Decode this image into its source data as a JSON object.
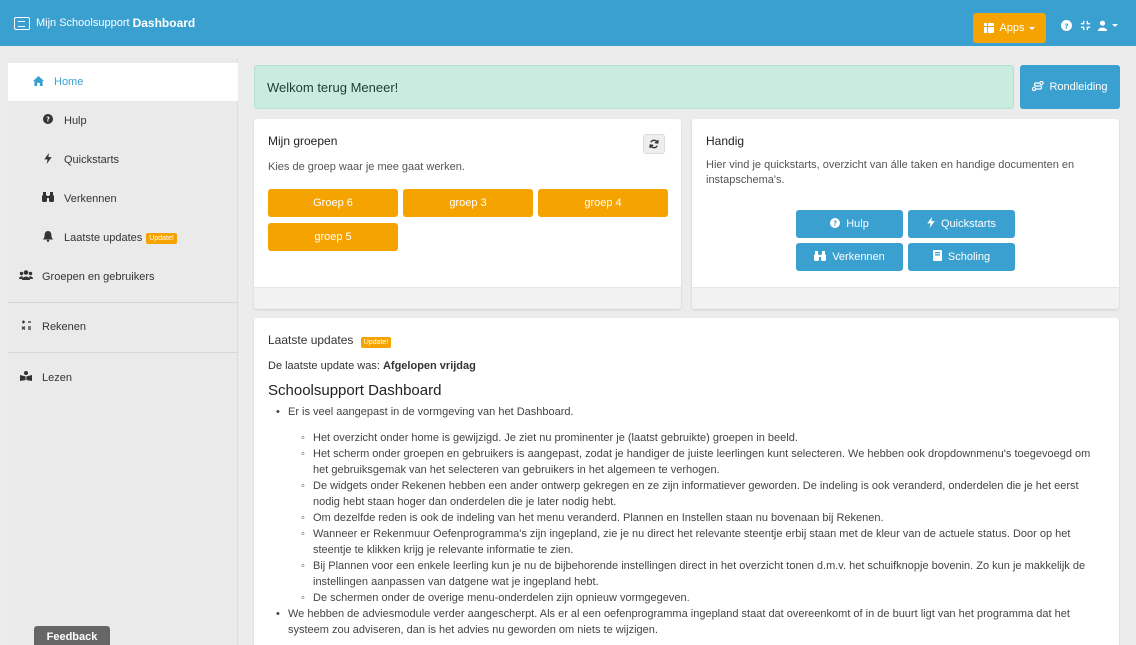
{
  "header": {
    "brand_prefix": "Mijn Schoolsupport",
    "brand_bold": "Dashboard",
    "apps_label": "Apps"
  },
  "sidebar": {
    "items": [
      {
        "label": "Home",
        "icon": "home-icon"
      },
      {
        "label": "Hulp",
        "icon": "question-circle-icon"
      },
      {
        "label": "Quickstarts",
        "icon": "bolt-icon"
      },
      {
        "label": "Verkennen",
        "icon": "binoculars-icon"
      },
      {
        "label": "Laatste updates",
        "icon": "bell-icon",
        "badge": "Update!"
      },
      {
        "label": "Groepen en gebruikers",
        "icon": "users-icon"
      },
      {
        "label": "Rekenen",
        "icon": "calculator-icon"
      },
      {
        "label": "Lezen",
        "icon": "reading-icon"
      }
    ],
    "feedback_label": "Feedback"
  },
  "welcome": {
    "text": "Welkom terug Meneer!",
    "tour_label": "Rondleiding"
  },
  "groups_panel": {
    "title": "Mijn groepen",
    "subtitle": "Kies de groep waar je mee gaat werken.",
    "groups": [
      "Groep 6",
      "groep 3",
      "groep 4",
      "groep 5"
    ]
  },
  "handy_panel": {
    "title": "Handig",
    "text": "Hier vind je quickstarts, overzicht van álle taken en handige documenten en instapschema's.",
    "buttons": [
      "Hulp",
      "Quickstarts",
      "Verkennen",
      "Scholing"
    ]
  },
  "updates": {
    "title": "Laatste updates",
    "badge": "Update!",
    "last_prefix": "De laatste update was:",
    "last_value": "Afgelopen vrijdag",
    "section_title": "Schoolsupport Dashboard",
    "bullets": [
      "Er is veel aangepast in de vormgeving van het Dashboard.",
      "We hebben de adviesmodule verder aangescherpt. Als er al een oefenprogramma ingepland staat dat overeenkomt of in de buurt ligt van het programma dat het systeem zou adviseren, dan is het advies nu geworden om niets te wijzigen."
    ],
    "sub_bullets": [
      "Het overzicht onder home is gewijzigd. Je ziet nu prominenter je (laatst gebruikte) groepen in beeld.",
      "Het scherm onder groepen en gebruikers is aangepast, zodat je handiger de juiste leerlingen kunt selecteren. We hebben ook dropdownmenu's toegevoegd om het gebruiksgemak van het selecteren van gebruikers in het algemeen te verhogen.",
      "De widgets onder Rekenen hebben een ander ontwerp gekregen en ze zijn informatiever geworden. De indeling is ook veranderd, onderdelen die je het eerst nodig hebt staan hoger dan onderdelen die je later nodig hebt.",
      "Om dezelfde reden is ook de indeling van het menu veranderd. Plannen en Instellen staan nu bovenaan bij Rekenen.",
      "Wanneer er Rekenmuur Oefenprogramma's zijn ingepland, zie je nu direct het relevante steentje erbij staan met de kleur van de actuele status. Door op het steentje te klikken krijg je relevante informatie te zien.",
      "Bij Plannen voor een enkele leerling kun je nu de bijbehorende instellingen direct in het overzicht tonen d.m.v. het schuifknopje bovenin. Zo kun je makkelijk de instellingen aanpassen van datgene wat je ingepland hebt.",
      "De schermen onder de overige menu-onderdelen zijn opnieuw vormgegeven."
    ]
  },
  "colors": {
    "header": "#3aa0cf",
    "accent_orange": "#f5a300",
    "welcome_bg": "#c9ece0"
  }
}
